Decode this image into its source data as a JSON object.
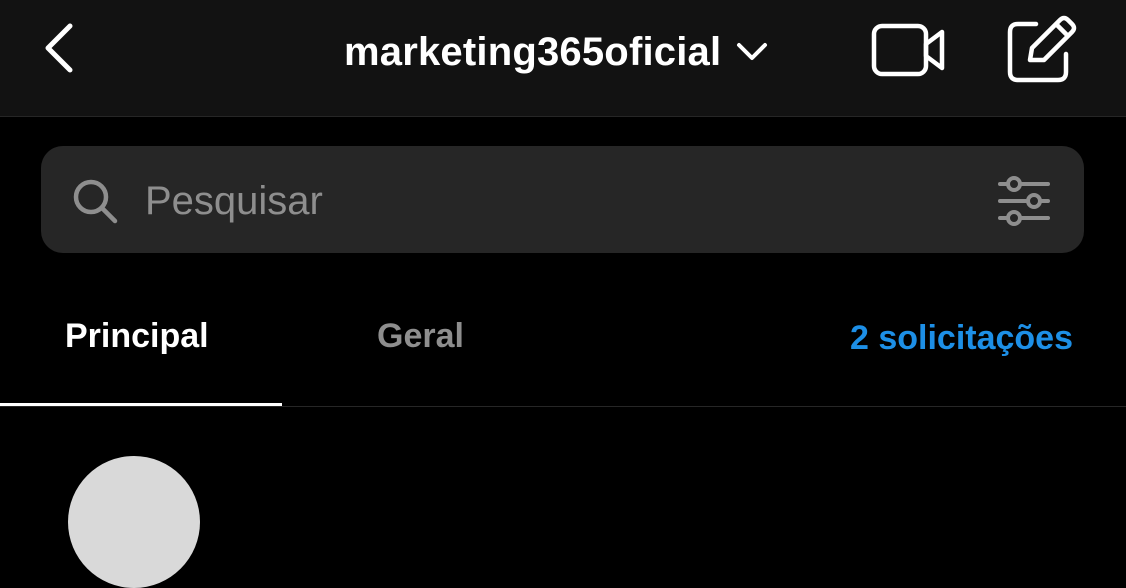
{
  "header": {
    "title": "marketing365oficial",
    "icons": {
      "back": "chevron-left-icon",
      "dropdown": "chevron-down-icon",
      "video": "video-camera-icon",
      "compose": "compose-icon"
    }
  },
  "search": {
    "placeholder": "Pesquisar",
    "icons": {
      "search": "search-icon",
      "filter": "filter-sliders-icon"
    }
  },
  "tabs": [
    {
      "label": "Principal",
      "active": true
    },
    {
      "label": "Geral",
      "active": false
    }
  ],
  "requests_link": "2 solicitações",
  "colors": {
    "background": "#000000",
    "header_bg": "#121212",
    "search_bg": "#262626",
    "muted_text": "#8e8e8e",
    "accent": "#1d8fe6"
  }
}
